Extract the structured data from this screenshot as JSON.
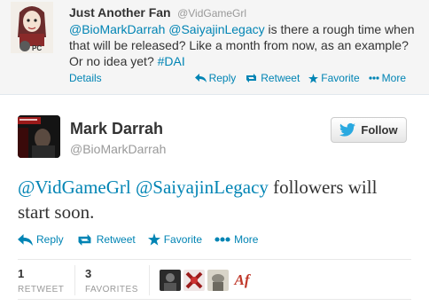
{
  "parent_tweet": {
    "name": "Just Another Fan",
    "handle": "@VidGameGrl",
    "text_link1": "@BioMarkDarrah",
    "text_link2": "@SaiyajinLegacy",
    "text_body": " is there a rough time when that will be released? Like a month from now, as an example? Or no idea yet? ",
    "hashtag": "#DAI",
    "details_label": "Details",
    "reply_label": "Reply",
    "retweet_label": "Retweet",
    "favorite_label": "Favorite",
    "more_label": "More"
  },
  "main_tweet": {
    "name": "Mark Darrah",
    "handle": "@BioMarkDarrah",
    "follow_label": "Follow",
    "text_link1": "@VidGameGrl",
    "text_link2": "@SaiyajinLegacy",
    "text_body": " followers will start soon.",
    "reply_label": "Reply",
    "retweet_label": "Retweet",
    "favorite_label": "Favorite",
    "more_label": "More"
  },
  "stats": {
    "retweet_count": "1",
    "retweet_label": "RETWEET",
    "favorites_count": "3",
    "favorites_label": "FAVORITES",
    "favoriter_avatar_text": "Af"
  },
  "colors": {
    "link": "#0084b4",
    "twitter_blue": "#2aa9e0"
  }
}
